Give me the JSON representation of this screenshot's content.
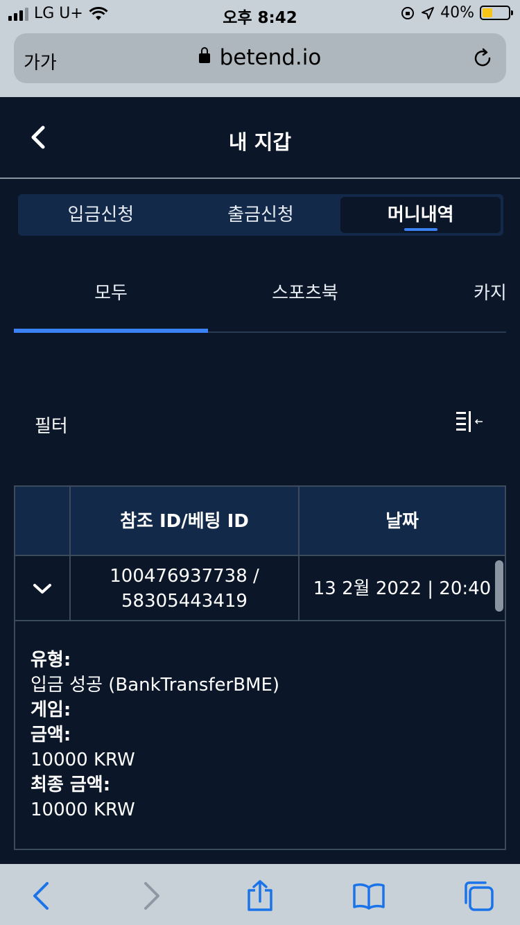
{
  "status_bar": {
    "carrier": "LG U+",
    "time": "오후 8:42",
    "battery_text": "40%",
    "battery_level": 0.4
  },
  "browser": {
    "text_size_label": "가가",
    "url": "betend.io"
  },
  "header": {
    "title": "내 지갑"
  },
  "main_tabs": [
    {
      "label": "입금신청",
      "active": false
    },
    {
      "label": "출금신청",
      "active": false
    },
    {
      "label": "머니내역",
      "active": true
    }
  ],
  "sub_tabs": [
    {
      "label": "모두",
      "active": true
    },
    {
      "label": "스포츠북",
      "active": false
    },
    {
      "label": "카지",
      "active": false
    }
  ],
  "filter": {
    "label": "필터"
  },
  "table": {
    "columns": [
      "",
      "참조 ID/베팅 ID",
      "날짜"
    ],
    "rows": [
      {
        "ref_id": "100476937738 /",
        "bet_id": "58305443419",
        "date": "13 2월 2022 | 20:40"
      }
    ],
    "details": [
      {
        "key": "유형:",
        "value": "입금 성공 (BankTransferBME)"
      },
      {
        "key": "게임:",
        "value": ""
      },
      {
        "key": "금액:",
        "value": "10000 KRW"
      },
      {
        "key": "최종 금액:",
        "value": "10000 KRW"
      }
    ]
  },
  "colors": {
    "background": "#0b1729",
    "accent": "#3b82f6",
    "tab_bg": "#13294a"
  }
}
